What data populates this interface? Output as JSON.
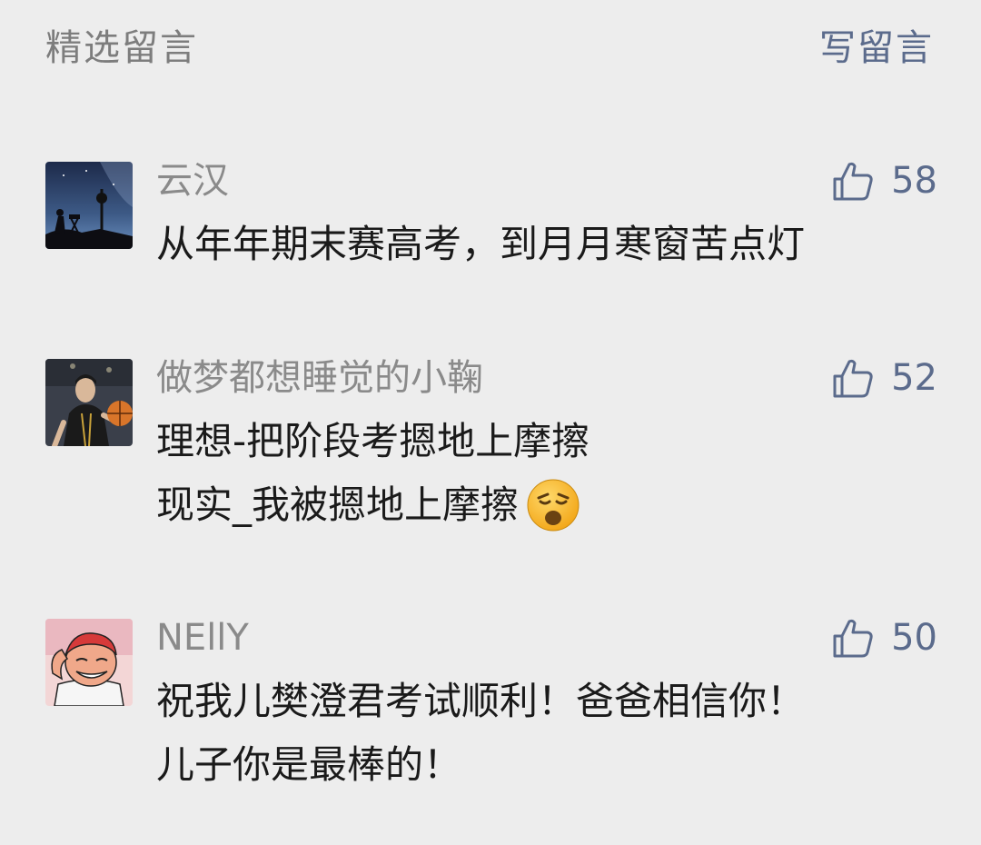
{
  "header": {
    "title": "精选留言",
    "write_label": "写留言"
  },
  "comments": [
    {
      "nickname": "云汉",
      "likes": "58",
      "lines": [
        "从年年期末赛高考，到月月寒窗苦点灯"
      ]
    },
    {
      "nickname": "做梦都想睡觉的小鞠",
      "likes": "52",
      "lines": [
        "理想-把阶段考摁地上摩擦",
        "现实_我被摁地上摩擦"
      ],
      "emoji": "frown-face-emoji"
    },
    {
      "nickname": "NEllY",
      "likes": "50",
      "lines": [
        "祝我儿樊澄君考试顺利！爸爸相信你！",
        "儿子你是最棒的！"
      ]
    }
  ],
  "colors": {
    "background": "#ededed",
    "link": "#5b6b8c",
    "nickname": "#8a8a8a",
    "text": "#1a1a1a"
  },
  "icons": {
    "like": "thumbs-up-icon"
  }
}
